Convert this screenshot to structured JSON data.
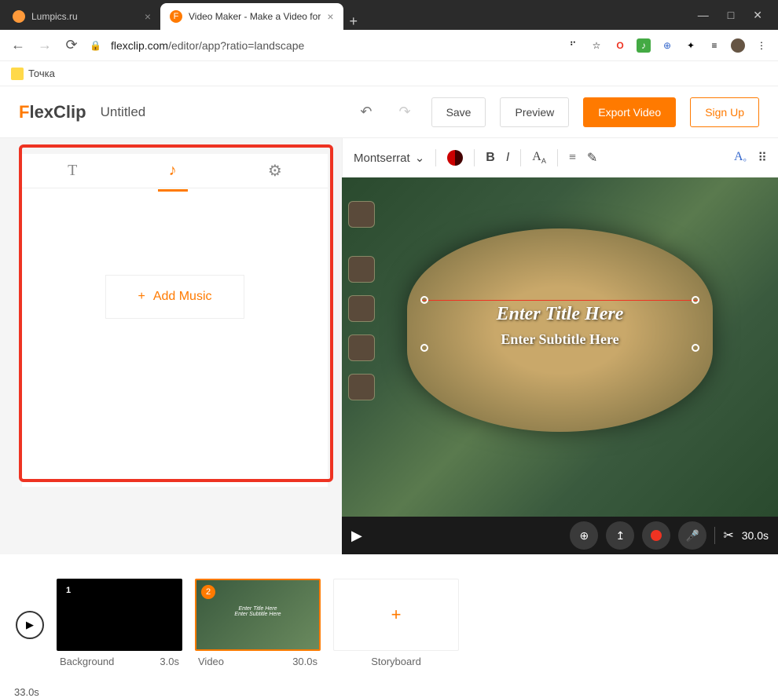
{
  "browser": {
    "tabs": [
      {
        "label": "Lumpics.ru",
        "favicon_color": "#ff9a3a"
      },
      {
        "label": "Video Maker - Make a Video for",
        "favicon_color": "#ff7a00",
        "favicon_text": "F"
      }
    ],
    "url_domain": "flexclip.com",
    "url_path": "/editor/app?ratio=landscape",
    "bookmark": "Точка"
  },
  "app": {
    "logo_prefix": "F",
    "logo_rest": "lexClip",
    "project_title": "Untitled",
    "save": "Save",
    "preview": "Preview",
    "export": "Export Video",
    "signup": "Sign Up"
  },
  "left_panel": {
    "add_music": "Add Music"
  },
  "toolbar": {
    "font": "Montserrat"
  },
  "overlay": {
    "title": "Enter Title Here",
    "subtitle": "Enter Subtitle Here"
  },
  "controls": {
    "duration": "30.0s"
  },
  "timeline": {
    "total": "33.0s",
    "clips": [
      {
        "num": "1",
        "name": "Background",
        "dur": "3.0s"
      },
      {
        "num": "2",
        "name": "Video",
        "dur": "30.0s"
      }
    ],
    "add_label": "Storyboard",
    "mini_title": "Enter Title Here",
    "mini_sub": "Enter Subtitle Here"
  }
}
